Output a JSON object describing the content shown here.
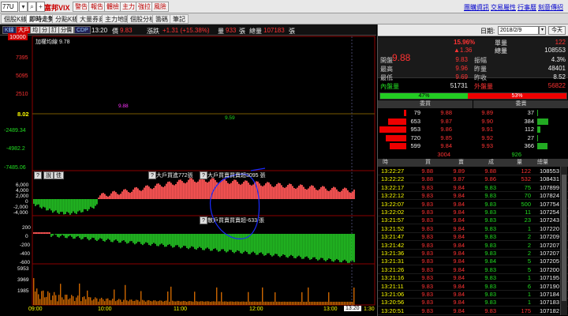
{
  "colors": {
    "up": "#ff3333",
    "down": "#22cc22",
    "volume": "#cc6600",
    "line_white": "#ffffff",
    "line_yellow": "#ffff00",
    "accent": "#ff3333"
  },
  "toolbar": {
    "symbol": "77U",
    "brand": "富邦VIX",
    "buttons": [
      "警告",
      "報告",
      "體檢",
      "主力",
      "強拉",
      "風險"
    ],
    "links": [
      "團購資訊",
      "交易屬性",
      "行事曆",
      "刻意傳招"
    ]
  },
  "tabs": [
    {
      "label": "個股K線",
      "active": false
    },
    {
      "label": "即時走勢",
      "active": true
    },
    {
      "label": "分點K線",
      "active": false
    },
    {
      "label": "大量券商",
      "active": false
    },
    {
      "label": "主力地圖",
      "active": false
    },
    {
      "label": "個股分析",
      "active": false
    },
    {
      "label": "籌碼",
      "active": false
    },
    {
      "label": "筆記",
      "active": false
    }
  ],
  "chart_header": {
    "mini_buttons": [
      {
        "label": "K線",
        "state": "blue"
      },
      {
        "label": "大戶",
        "state": "on"
      },
      {
        "label": "均",
        "state": "off"
      },
      {
        "label": "分",
        "state": "off"
      },
      {
        "label": "訂",
        "state": "off"
      },
      {
        "label": "分價",
        "state": "off"
      },
      {
        "label": "CDP",
        "state": "blue"
      }
    ],
    "time": "13:20",
    "price_label": "價",
    "price": "9.83",
    "change_label": "漲跌",
    "change": "+1.31 (+15.38%)",
    "vol_label": "量",
    "vol": "933",
    "unit": "張",
    "total_label": "總量",
    "total": "107183",
    "unit2": "張"
  },
  "chart": {
    "legend": "加權均線 9.78",
    "price_axis": [
      "10000",
      "7395",
      "5095",
      "2510",
      "8.02",
      "-2489.34",
      "-4982.2",
      "-7485.06"
    ],
    "ref_value": "8.52",
    "annotations": [
      "9.88",
      "9.59"
    ],
    "sub_buttons": [
      "?",
      "說",
      "佳"
    ],
    "big_buy_label": "大戶買進772張",
    "big_diff_label": "大戶買賣買賣超3095 張",
    "retail_label": "散戶買賣買賣超-633 張",
    "mid_axis": [
      "6,000",
      "4,000",
      "2,000",
      "0",
      "-2,000",
      "-4,000"
    ],
    "low_axis": [
      "200",
      "0",
      "-200",
      "-400",
      "-600"
    ],
    "vol_axis": [
      "5953",
      "3969",
      "1985"
    ],
    "time_axis": [
      "09:00",
      "10:00",
      "11:00",
      "12:00",
      "13:00"
    ],
    "cursor_time": "13:20",
    "end_time": "1:30"
  },
  "right_panel": {
    "date_label": "日期:",
    "date": "2018/2/9",
    "today_button": "今天",
    "price": "9.88",
    "pct": "15.96%",
    "chg": "▲1.36",
    "quote_rows": [
      {
        "label": "單量",
        "value": "122"
      },
      {
        "label": "總量",
        "value": "108553"
      }
    ],
    "stats": [
      {
        "l1": "開盤",
        "v1": "9.83",
        "l2": "振幅",
        "v2": "4.3%"
      },
      {
        "l1": "最高",
        "v1": "9.96",
        "l2": "昨量",
        "v2": "48401"
      },
      {
        "l1": "最低",
        "v1": "9.69",
        "l2": "昨收",
        "v2": "8.52"
      }
    ],
    "inner_label": "內盤量",
    "inner_vol": "51731",
    "outer_label": "外盤量",
    "outer_vol": "56822",
    "ratio_green": "47%",
    "ratio_red": "53%",
    "ratio_green_frac": 0.47,
    "orderbook_head": [
      "委買",
      "委賣"
    ],
    "orderbook": [
      {
        "bid_vol": "79",
        "bid": "9.88",
        "ask": "9.89",
        "ask_vol": "37"
      },
      {
        "bid_vol": "653",
        "bid": "9.87",
        "ask": "9.90",
        "ask_vol": "384"
      },
      {
        "bid_vol": "953",
        "bid": "9.86",
        "ask": "9.91",
        "ask_vol": "112"
      },
      {
        "bid_vol": "720",
        "bid": "9.85",
        "ask": "9.92",
        "ask_vol": "27"
      },
      {
        "bid_vol": "599",
        "bid": "9.84",
        "ask": "9.93",
        "ask_vol": "366"
      }
    ],
    "bid_total": "3004",
    "ask_total": "926",
    "tick_head": [
      "時",
      "買",
      "賣",
      "成",
      "量",
      "總量"
    ],
    "ticks": [
      {
        "t": "13:22:27",
        "b": "9.88",
        "s": "9.89",
        "p": "9.88",
        "v": "122",
        "tot": "108553",
        "c": "red"
      },
      {
        "t": "13:22:22",
        "b": "9.88",
        "s": "9.87",
        "p": "9.86",
        "v": "532",
        "tot": "108431",
        "c": "red"
      },
      {
        "t": "13:22:17",
        "b": "9.83",
        "s": "9.84",
        "p": "9.83",
        "v": "75",
        "tot": "107899",
        "c": "grn"
      },
      {
        "t": "13:22:12",
        "b": "9.83",
        "s": "9.84",
        "p": "9.83",
        "v": "70",
        "tot": "107824",
        "c": "grn"
      },
      {
        "t": "13:22:07",
        "b": "9.83",
        "s": "9.84",
        "p": "9.83",
        "v": "500",
        "tot": "107754",
        "c": "grn"
      },
      {
        "t": "13:22:02",
        "b": "9.83",
        "s": "9.84",
        "p": "9.83",
        "v": "11",
        "tot": "107254",
        "c": "grn"
      },
      {
        "t": "13:21:57",
        "b": "9.83",
        "s": "9.84",
        "p": "9.83",
        "v": "23",
        "tot": "107243",
        "c": "grn"
      },
      {
        "t": "13:21:52",
        "b": "9.83",
        "s": "9.84",
        "p": "9.83",
        "v": "1",
        "tot": "107220",
        "c": "grn"
      },
      {
        "t": "13:21:47",
        "b": "9.83",
        "s": "9.84",
        "p": "9.83",
        "v": "2",
        "tot": "107209",
        "c": "grn"
      },
      {
        "t": "13:21:42",
        "b": "9.83",
        "s": "9.84",
        "p": "9.83",
        "v": "2",
        "tot": "107207",
        "c": "grn"
      },
      {
        "t": "13:21:36",
        "b": "9.83",
        "s": "9.84",
        "p": "9.83",
        "v": "2",
        "tot": "107207",
        "c": "grn"
      },
      {
        "t": "13:21:31",
        "b": "9.83",
        "s": "9.84",
        "p": "9.84",
        "v": "5",
        "tot": "107205",
        "c": "grn"
      },
      {
        "t": "13:21:26",
        "b": "9.83",
        "s": "9.84",
        "p": "9.83",
        "v": "5",
        "tot": "107200",
        "c": "grn"
      },
      {
        "t": "13:21:16",
        "b": "9.83",
        "s": "9.84",
        "p": "9.83",
        "v": "1",
        "tot": "107195",
        "c": "grn"
      },
      {
        "t": "13:21:11",
        "b": "9.83",
        "s": "9.84",
        "p": "9.83",
        "v": "6",
        "tot": "107190",
        "c": "grn"
      },
      {
        "t": "13:21:06",
        "b": "9.83",
        "s": "9.84",
        "p": "9.83",
        "v": "1",
        "tot": "107184",
        "c": "grn"
      },
      {
        "t": "13:20:56",
        "b": "9.83",
        "s": "9.84",
        "p": "9.83",
        "v": "1",
        "tot": "107183",
        "c": "grn"
      },
      {
        "t": "13:20:51",
        "b": "9.83",
        "s": "9.84",
        "p": "9.83",
        "v": "175",
        "tot": "107182",
        "c": "red"
      }
    ]
  }
}
